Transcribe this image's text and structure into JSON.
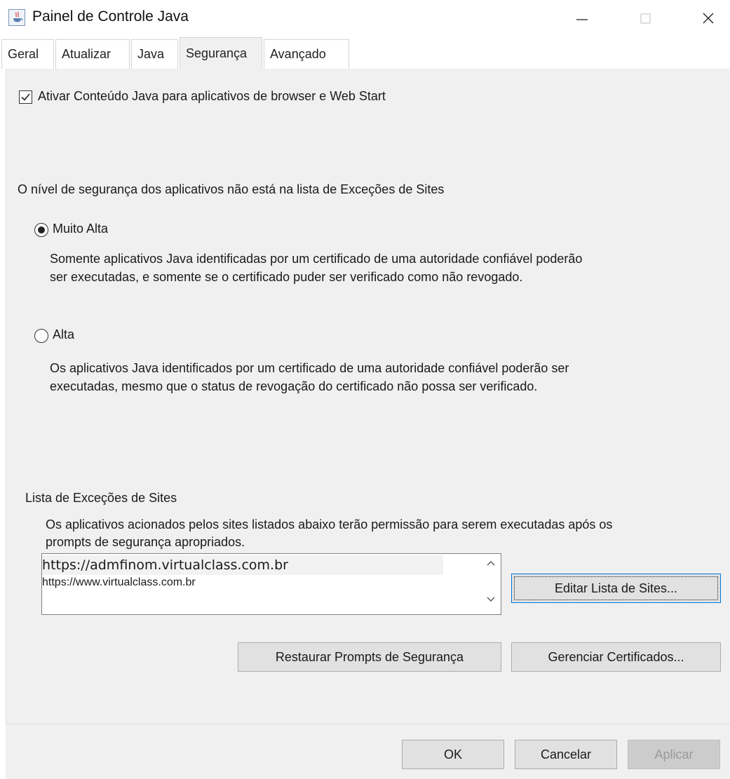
{
  "window": {
    "title": "Painel de Controle Java",
    "icon": "java-icon"
  },
  "tabs": [
    {
      "label": "Geral",
      "active": false
    },
    {
      "label": "Atualizar",
      "active": false
    },
    {
      "label": "Java",
      "active": false
    },
    {
      "label": "Segurança",
      "active": true
    },
    {
      "label": "Avançado",
      "active": false
    }
  ],
  "security": {
    "enable_java_label": "Ativar Conteúdo Java para aplicativos de browser e Web Start",
    "enable_java_checked": true,
    "level_heading": "O nível de segurança dos aplicativos não está na lista de Exceções de Sites",
    "very_high": {
      "label": "Muito Alta",
      "selected": true,
      "desc_line1": "Somente aplicativos Java identificadas por um certificado de uma autoridade confiável poderão",
      "desc_line2": "ser executadas, e somente se o certificado puder ser verificado como não revogado."
    },
    "high": {
      "label": "Alta",
      "selected": false,
      "desc_line1": "Os aplicativos Java identificados por um certificado de uma autoridade confiável poderão ser",
      "desc_line2": "executadas, mesmo que o status de revogação do certificado não possa ser verificado."
    }
  },
  "exceptions": {
    "heading": "Lista de Exceções de Sites",
    "desc_line1": "Os aplicativos acionados pelos sites listados abaixo terão permissão para serem executadas após os",
    "desc_line2": "prompts de segurança apropriados.",
    "sites": [
      "https://admfinom.virtualclass.com.br",
      "https://www.virtualclass.com.br"
    ],
    "edit_button": "Editar Lista de Sites..."
  },
  "actions": {
    "restore_prompts": "Restaurar Prompts de Segurança",
    "manage_certs": "Gerenciar Certificados..."
  },
  "footer": {
    "ok": "OK",
    "cancel": "Cancelar",
    "apply": "Aplicar",
    "apply_enabled": false
  }
}
